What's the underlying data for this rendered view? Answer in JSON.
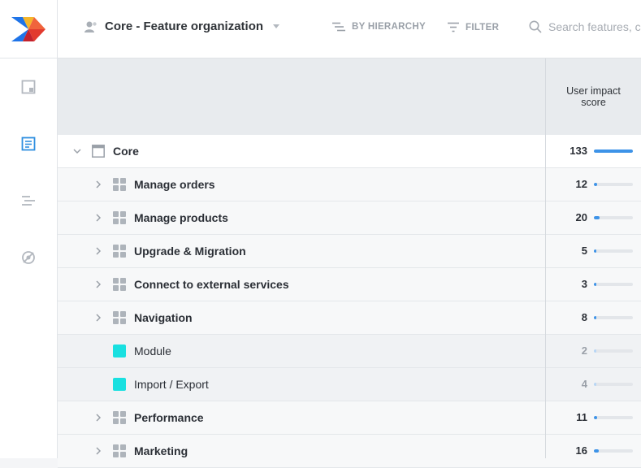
{
  "app": {
    "board_title": "Core - Feature organization",
    "nav": [
      "board-icon",
      "document-icon",
      "roadmap-icon",
      "insights-icon"
    ]
  },
  "toolbar": {
    "hierarchy_label": "BY HIERARCHY",
    "filter_label": "FILTER",
    "search_placeholder": "Search features, co"
  },
  "table": {
    "score_header": "User impact score",
    "rows": [
      {
        "label": "Core",
        "score": "133",
        "value": 133,
        "level": 0,
        "bold": true,
        "expanded": true
      },
      {
        "label": "Manage orders",
        "score": "12",
        "value": 12,
        "level": 1,
        "bold": true
      },
      {
        "label": "Manage products",
        "score": "20",
        "value": 20,
        "level": 1,
        "bold": true
      },
      {
        "label": "Upgrade & Migration",
        "score": "5",
        "value": 5,
        "level": 1,
        "bold": true
      },
      {
        "label": "Connect to external services",
        "score": "3",
        "value": 3,
        "level": 1,
        "bold": true
      },
      {
        "label": "Navigation",
        "score": "8",
        "value": 8,
        "level": 1,
        "bold": true
      },
      {
        "label": "Module",
        "score": "2",
        "value": 2,
        "level": 2,
        "bold": false
      },
      {
        "label": "Import / Export",
        "score": "4",
        "value": 4,
        "level": 2,
        "bold": false
      },
      {
        "label": "Performance",
        "score": "11",
        "value": 11,
        "level": 1,
        "bold": true
      },
      {
        "label": "Marketing",
        "score": "16",
        "value": 16,
        "level": 1,
        "bold": true
      }
    ],
    "max_value": 133
  },
  "colors": {
    "accent": "#3d93e8",
    "feature_icon": "#19e0e0",
    "component_icon": "#aeb4bb"
  }
}
